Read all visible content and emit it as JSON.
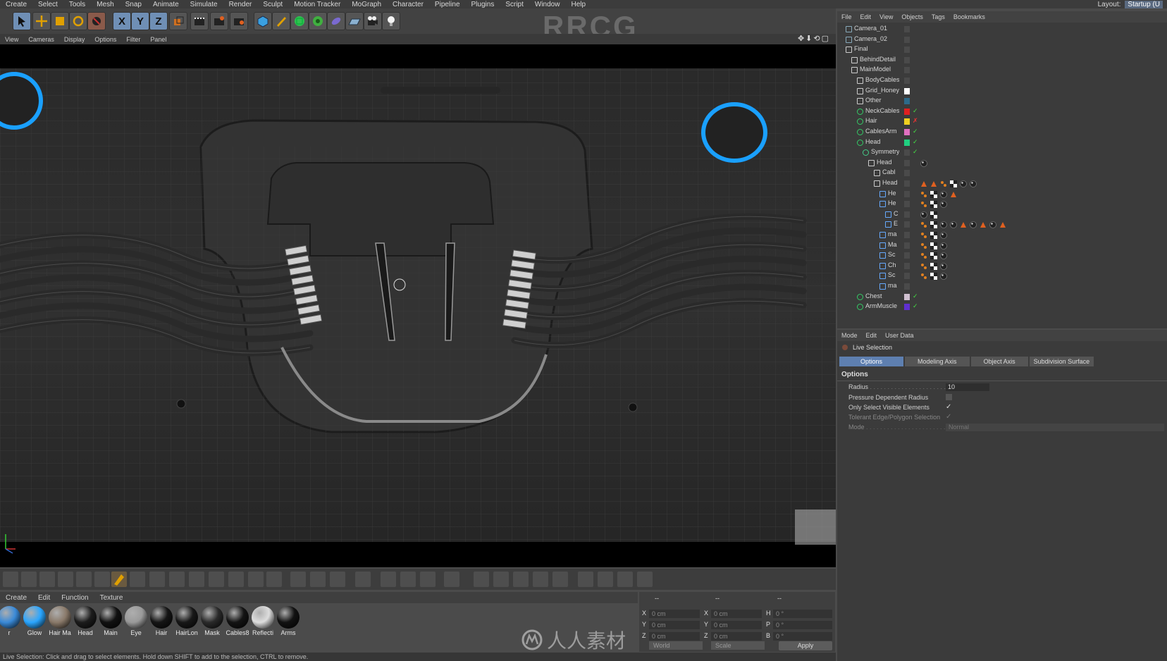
{
  "menubar": {
    "items": [
      "Create",
      "Select",
      "Tools",
      "Mesh",
      "Snap",
      "Animate",
      "Simulate",
      "Render",
      "Sculpt",
      "Motion Tracker",
      "MoGraph",
      "Character",
      "Pipeline",
      "Plugins",
      "Script",
      "Window",
      "Help"
    ],
    "layout_label": "Layout:",
    "layout_value": "Startup (U"
  },
  "toolbar": {
    "watermark": "RRCG",
    "axis_x": "X",
    "axis_y": "Y",
    "axis_z": "Z"
  },
  "viewport": {
    "menu": [
      "View",
      "Cameras",
      "Display",
      "Options",
      "Filter",
      "Panel"
    ],
    "nav_icons": "✥⬇⟲▢"
  },
  "material_manager": {
    "menu": [
      "Create",
      "Edit",
      "Function",
      "Texture"
    ],
    "materials": [
      {
        "name": "r",
        "color": "#3a8ad8"
      },
      {
        "name": "Glow",
        "color": "#2aa6ff"
      },
      {
        "name": "Hair Ma",
        "color": "#8a7a6a"
      },
      {
        "name": "Head",
        "color": "#1c1c1c"
      },
      {
        "name": "Main",
        "color": "#111111"
      },
      {
        "name": "Eye",
        "color": "#9a9a9a"
      },
      {
        "name": "Hair",
        "color": "#151515"
      },
      {
        "name": "HairLon",
        "color": "#181818"
      },
      {
        "name": "Mask",
        "color": "#2a2a2a"
      },
      {
        "name": "Cables8",
        "color": "#141414"
      },
      {
        "name": "Reflecti",
        "color": "#dddddd"
      },
      {
        "name": "Arms",
        "color": "#121212"
      }
    ]
  },
  "coordinates": {
    "header": [
      "--",
      "--",
      "--"
    ],
    "rows": [
      {
        "a": "X",
        "av": "0 cm",
        "b": "X",
        "bv": "0 cm",
        "c": "H",
        "cv": "0 °"
      },
      {
        "a": "Y",
        "av": "0 cm",
        "b": "Y",
        "bv": "0 cm",
        "c": "P",
        "cv": "0 °"
      },
      {
        "a": "Z",
        "av": "0 cm",
        "b": "Z",
        "bv": "0 cm",
        "c": "B",
        "cv": "0 °"
      }
    ],
    "world": "World",
    "scale": "Scale",
    "apply": "Apply"
  },
  "status_bar": "Live Selection: Click and drag to select elements. Hold down SHIFT to add to the selection, CTRL to remove.",
  "object_manager": {
    "menu": [
      "File",
      "Edit",
      "View",
      "Objects",
      "Tags",
      "Bookmarks"
    ],
    "rows": [
      {
        "name": "Camera_01",
        "indent": 0,
        "icon": "camera",
        "swatch": "",
        "flag": ""
      },
      {
        "name": "Camera_02",
        "indent": 0,
        "icon": "camera",
        "swatch": "",
        "flag": ""
      },
      {
        "name": "Final",
        "indent": 0,
        "icon": "null",
        "swatch": "",
        "flag": ""
      },
      {
        "name": "BehindDetail",
        "indent": 1,
        "icon": "null",
        "swatch": "",
        "flag": ""
      },
      {
        "name": "MainModel",
        "indent": 1,
        "icon": "null",
        "swatch": "",
        "flag": ""
      },
      {
        "name": "BodyCables",
        "indent": 2,
        "icon": "null",
        "swatch": "",
        "flag": ""
      },
      {
        "name": "Grid_Honey",
        "indent": 2,
        "icon": "null",
        "swatch": "#ffffff",
        "flag": ""
      },
      {
        "name": "Other",
        "indent": 2,
        "icon": "null",
        "swatch": "#2d6a8a",
        "flag": ""
      },
      {
        "name": "NeckCables",
        "indent": 2,
        "icon": "gear",
        "swatch": "#e02020",
        "flag": "✓"
      },
      {
        "name": "Hair",
        "indent": 2,
        "icon": "gear",
        "swatch": "#f0d020",
        "flag": "✗"
      },
      {
        "name": "CablesArm",
        "indent": 2,
        "icon": "gear",
        "swatch": "#e070c0",
        "flag": "✓"
      },
      {
        "name": "Head",
        "indent": 2,
        "icon": "gear",
        "swatch": "#20d080",
        "flag": "✓"
      },
      {
        "name": "Symmetry",
        "indent": 3,
        "icon": "sym",
        "swatch": "",
        "flag": "✓"
      },
      {
        "name": "Head",
        "indent": 4,
        "icon": "null",
        "swatch": "",
        "flag": ""
      },
      {
        "name": "Cabl",
        "indent": 5,
        "icon": "null",
        "swatch": "",
        "flag": ""
      },
      {
        "name": "Head",
        "indent": 5,
        "icon": "null",
        "swatch": "",
        "flag": ""
      },
      {
        "name": "He",
        "indent": 6,
        "icon": "poly",
        "swatch": "",
        "flag": ""
      },
      {
        "name": "He",
        "indent": 6,
        "icon": "poly",
        "swatch": "",
        "flag": ""
      },
      {
        "name": "C",
        "indent": 7,
        "icon": "poly",
        "swatch": "",
        "flag": ""
      },
      {
        "name": "E",
        "indent": 7,
        "icon": "poly",
        "swatch": "",
        "flag": ""
      },
      {
        "name": "ma",
        "indent": 6,
        "icon": "poly",
        "swatch": "",
        "flag": ""
      },
      {
        "name": "Ma",
        "indent": 6,
        "icon": "poly",
        "swatch": "",
        "flag": ""
      },
      {
        "name": "Sc",
        "indent": 6,
        "icon": "poly",
        "swatch": "",
        "flag": ""
      },
      {
        "name": "Ch",
        "indent": 6,
        "icon": "poly",
        "swatch": "",
        "flag": ""
      },
      {
        "name": "Sc",
        "indent": 6,
        "icon": "poly",
        "swatch": "",
        "flag": ""
      },
      {
        "name": "ma",
        "indent": 6,
        "icon": "poly",
        "swatch": "",
        "flag": ""
      },
      {
        "name": "Chest",
        "indent": 2,
        "icon": "gear",
        "swatch": "#d0c0d0",
        "flag": "✓"
      },
      {
        "name": "ArmMuscle",
        "indent": 2,
        "icon": "gear",
        "swatch": "#6030d0",
        "flag": "✓"
      }
    ],
    "tags": [
      [],
      [],
      [],
      [],
      [],
      [],
      [],
      [],
      [],
      [],
      [],
      [],
      [],
      [
        "ball"
      ],
      [],
      [
        "tri",
        "tri",
        "dot",
        "check",
        "ball",
        "ball"
      ],
      [
        "dot",
        "check",
        "ball",
        "tri"
      ],
      [
        "dot",
        "check",
        "ball"
      ],
      [
        "ball",
        "check"
      ],
      [
        "dot",
        "check",
        "ball",
        "ball",
        "tri",
        "ball",
        "tri",
        "ball",
        "tri"
      ],
      [
        "dot",
        "check",
        "ball"
      ],
      [
        "dot",
        "check",
        "ball"
      ],
      [
        "dot",
        "check",
        "ball"
      ],
      [
        "dot",
        "check",
        "ball"
      ],
      [
        "dot",
        "check",
        "ball"
      ],
      [],
      []
    ]
  },
  "attribute_manager": {
    "menu": [
      "Mode",
      "Edit",
      "User Data"
    ],
    "tool_name": "Live Selection",
    "tabs": [
      "Options",
      "Modeling Axis",
      "Object Axis",
      "Subdivision Surface"
    ],
    "section": "Options",
    "radius_label": "Radius",
    "radius_value": "10",
    "pressure_label": "Pressure Dependent Radius",
    "visible_label": "Only Select Visible Elements",
    "tolerant_label": "Tolerant Edge/Polygon Selection",
    "mode_label": "Mode",
    "mode_value": "Normal"
  },
  "footer_watermark": "人人素材"
}
